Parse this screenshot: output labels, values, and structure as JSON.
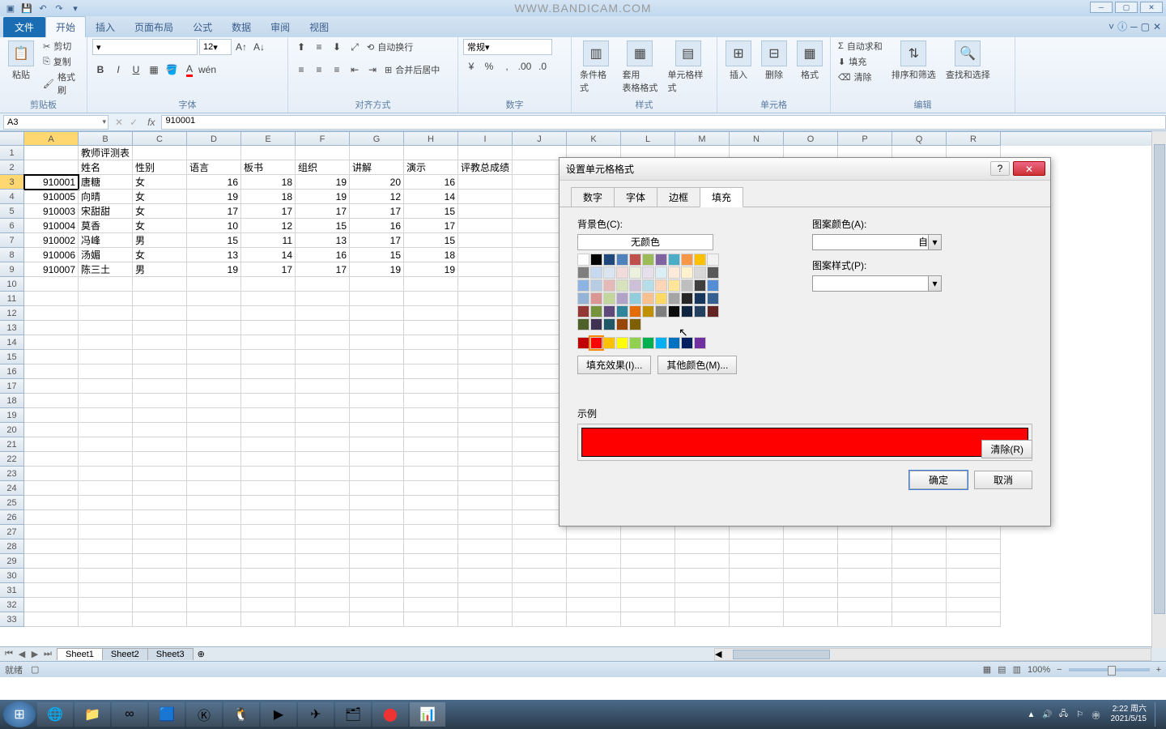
{
  "watermark": "WWW.BANDICAM.COM",
  "ribbon": {
    "file": "文件",
    "tabs": [
      "开始",
      "插入",
      "页面布局",
      "公式",
      "数据",
      "审阅",
      "视图"
    ],
    "active": 0,
    "groups": {
      "clipboard": {
        "label": "剪贴板",
        "paste": "粘贴",
        "cut": "剪切",
        "copy": "复制",
        "painter": "格式刷"
      },
      "font": {
        "label": "字体",
        "size": "12",
        "bold": "B",
        "italic": "I",
        "underline": "U"
      },
      "align": {
        "label": "对齐方式",
        "wrap": "自动换行",
        "merge": "合并后居中"
      },
      "number": {
        "label": "数字",
        "format": "常规"
      },
      "styles": {
        "label": "样式",
        "cond": "条件格式",
        "table": "套用\n表格格式",
        "cell": "单元格样式"
      },
      "cells": {
        "label": "单元格",
        "insert": "插入",
        "delete": "删除",
        "format": "格式"
      },
      "editing": {
        "label": "编辑",
        "sum": "自动求和",
        "fill": "填充",
        "clear": "清除",
        "sort": "排序和筛选",
        "find": "查找和选择"
      }
    }
  },
  "namebox": "A3",
  "formula": "910001",
  "cols": [
    "A",
    "B",
    "C",
    "D",
    "E",
    "F",
    "G",
    "H",
    "I",
    "J",
    "K",
    "L",
    "M",
    "N",
    "O",
    "P",
    "Q",
    "R"
  ],
  "data": {
    "r1": {
      "B": "教师评测表"
    },
    "r2": {
      "B": "姓名",
      "C": "性别",
      "D": "语言",
      "E": "板书",
      "F": "组织",
      "G": "讲解",
      "H": "演示",
      "I": "评教总成绩"
    },
    "r3": {
      "A": "910001",
      "B": "唐糖",
      "C": "女",
      "D": "16",
      "E": "18",
      "F": "19",
      "G": "20",
      "H": "16"
    },
    "r4": {
      "A": "910005",
      "B": "向晴",
      "C": "女",
      "D": "19",
      "E": "18",
      "F": "19",
      "G": "12",
      "H": "14"
    },
    "r5": {
      "A": "910003",
      "B": "宋甜甜",
      "C": "女",
      "D": "17",
      "E": "17",
      "F": "17",
      "G": "17",
      "H": "15"
    },
    "r6": {
      "A": "910004",
      "B": "莫香",
      "C": "女",
      "D": "10",
      "E": "12",
      "F": "15",
      "G": "16",
      "H": "17"
    },
    "r7": {
      "A": "910002",
      "B": "冯峰",
      "C": "男",
      "D": "15",
      "E": "11",
      "F": "13",
      "G": "17",
      "H": "15"
    },
    "r8": {
      "A": "910006",
      "B": "汤媚",
      "C": "女",
      "D": "13",
      "E": "14",
      "F": "16",
      "G": "15",
      "H": "18"
    },
    "r9": {
      "A": "910007",
      "B": "陈三土",
      "C": "男",
      "D": "19",
      "E": "17",
      "F": "17",
      "G": "19",
      "H": "19"
    }
  },
  "sheets": [
    "Sheet1",
    "Sheet2",
    "Sheet3"
  ],
  "status": {
    "ready": "就绪",
    "zoom": "100%"
  },
  "dialog": {
    "title": "设置单元格格式",
    "tabs": [
      "数字",
      "字体",
      "边框",
      "填充"
    ],
    "active": 3,
    "bgcolor_label": "背景色(C):",
    "nocolor": "无颜色",
    "fill_effects": "填充效果(I)...",
    "more_colors": "其他颜色(M)...",
    "pattern_color_label": "图案颜色(A):",
    "pattern_color_val": "自动",
    "pattern_style_label": "图案样式(P):",
    "sample_label": "示例",
    "clear": "清除(R)",
    "ok": "确定",
    "cancel": "取消",
    "sample_color": "#ff0000"
  },
  "clock": {
    "time": "2:22 周六",
    "date": "2021/5/15"
  },
  "theme_row": [
    "#ffffff",
    "#000000",
    "#1f497d",
    "#4f81bd",
    "#c0504d",
    "#9bbb59",
    "#8064a2",
    "#4bacc6",
    "#f79646",
    "#ffc000"
  ],
  "tint_rows": [
    [
      "#f2f2f2",
      "#7f7f7f",
      "#c6d9f0",
      "#dbe5f1",
      "#f2dcdb",
      "#ebf1dd",
      "#e5e0ec",
      "#dbeef3",
      "#fdeada",
      "#fff2cc"
    ],
    [
      "#d8d8d8",
      "#595959",
      "#8db3e2",
      "#b8cce4",
      "#e5b9b7",
      "#d7e3bc",
      "#ccc1d9",
      "#b7dde8",
      "#fbd5b5",
      "#ffe599"
    ],
    [
      "#bfbfbf",
      "#3f3f3f",
      "#548dd4",
      "#95b3d7",
      "#d99694",
      "#c3d69b",
      "#b2a2c7",
      "#92cddc",
      "#fac08f",
      "#ffd966"
    ],
    [
      "#a5a5a5",
      "#262626",
      "#17365d",
      "#366092",
      "#953734",
      "#76923c",
      "#5f497a",
      "#31859b",
      "#e36c09",
      "#bf9000"
    ],
    [
      "#7f7f7f",
      "#0c0c0c",
      "#0f243e",
      "#244061",
      "#632423",
      "#4f6128",
      "#3f3151",
      "#205867",
      "#974806",
      "#7f6000"
    ]
  ],
  "std_colors": [
    "#c00000",
    "#ff0000",
    "#ffc000",
    "#ffff00",
    "#92d050",
    "#00b050",
    "#00b0f0",
    "#0070c0",
    "#002060",
    "#7030a0"
  ]
}
